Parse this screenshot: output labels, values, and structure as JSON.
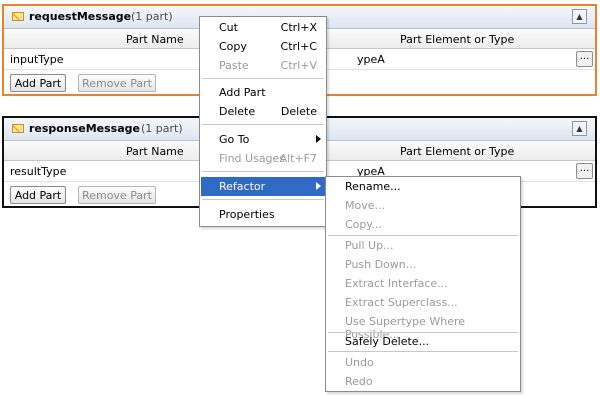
{
  "panels": [
    {
      "title": "requestMessage",
      "count": "(1 part)",
      "col_name": "Part Name",
      "col_type": "Part Element or Type",
      "row_name": "inputType",
      "row_type": "ypeA",
      "dots": "...",
      "add_label": "Add Part",
      "remove_label": "Remove Part",
      "collapse": "▲"
    },
    {
      "title": "responseMessage",
      "count": "(1 part)",
      "col_name": "Part Name",
      "col_type": "Part Element or Type",
      "row_name": "resultType",
      "row_type": "ypeA",
      "dots": "...",
      "add_label": "Add Part",
      "remove_label": "Remove Part",
      "collapse": "▲"
    }
  ],
  "context_menu": [
    {
      "label": "Cut",
      "accel": "Ctrl+X",
      "enabled": true
    },
    {
      "label": "Copy",
      "accel": "Ctrl+C",
      "enabled": true
    },
    {
      "label": "Paste",
      "accel": "Ctrl+V",
      "enabled": false
    },
    {
      "label": "Add Part",
      "accel": "",
      "enabled": true
    },
    {
      "label": "Delete",
      "accel": "Delete",
      "enabled": true
    },
    {
      "label": "Go To",
      "accel": "",
      "enabled": true,
      "submenu": true
    },
    {
      "label": "Find Usages",
      "accel": "Alt+F7",
      "enabled": false
    },
    {
      "label": "Refactor",
      "accel": "",
      "enabled": true,
      "submenu": true,
      "highlighted": true
    },
    {
      "label": "Properties",
      "accel": "",
      "enabled": true
    }
  ],
  "refactor_menu": [
    {
      "label": "Rename...",
      "enabled": true
    },
    {
      "label": "Move...",
      "enabled": false
    },
    {
      "label": "Copy...",
      "enabled": false
    },
    {
      "label": "Pull Up...",
      "enabled": false
    },
    {
      "label": "Push Down...",
      "enabled": false
    },
    {
      "label": "Extract Interface...",
      "enabled": false
    },
    {
      "label": "Extract Superclass...",
      "enabled": false
    },
    {
      "label": "Use Supertype Where Possible...",
      "enabled": false
    },
    {
      "label": "Safely Delete...",
      "enabled": true
    },
    {
      "label": "Undo",
      "enabled": false
    },
    {
      "label": "Redo",
      "enabled": false
    }
  ],
  "colors": {
    "selected_border": "#e8822e",
    "highlight": "#316ac5"
  }
}
